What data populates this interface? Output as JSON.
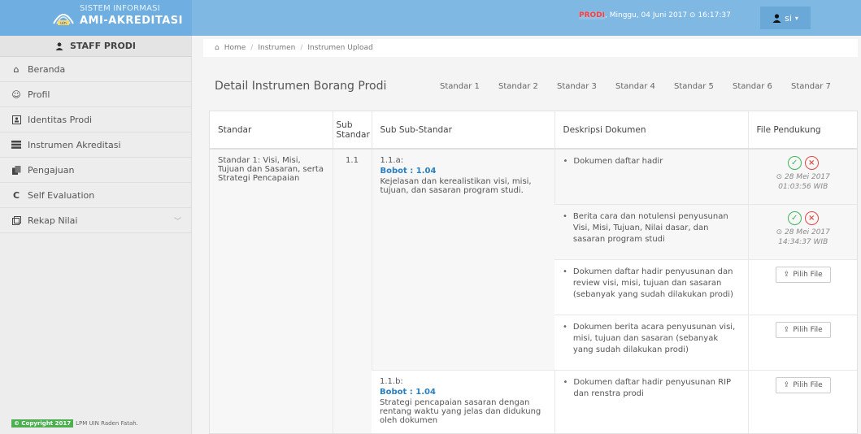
{
  "brand": {
    "line1": "SISTEM INFORMASI",
    "line2": "AMI-AKREDITASI"
  },
  "topbar": {
    "prodi": "PRODI",
    "datetime": ", Minggu, 04 Juni 2017 ⊙ 16:17:37",
    "user": "si"
  },
  "sidebar": {
    "header": "STAFF PRODI",
    "items": [
      {
        "label": "Beranda",
        "icon": "home-icon"
      },
      {
        "label": "Profil",
        "icon": "user-circle-icon"
      },
      {
        "label": "Identitas Prodi",
        "icon": "id-card-icon"
      },
      {
        "label": "Instrumen Akreditasi",
        "icon": "server-icon"
      },
      {
        "label": "Pengajuan",
        "icon": "copy-icon"
      },
      {
        "label": "Self Evaluation",
        "icon": "refresh-icon"
      },
      {
        "label": "Rekap Nilai",
        "icon": "clone-icon"
      }
    ],
    "copyright_badge": "© Copyright 2017",
    "copyright_text": "LPM UIN Raden Fatah."
  },
  "breadcrumb": {
    "home": "Home",
    "b1": "Instrumen",
    "b2": "Instrumen Upload"
  },
  "title": "Detail Instrumen Borang Prodi",
  "tabs": [
    "Standar 1",
    "Standar 2",
    "Standar 3",
    "Standar 4",
    "Standar 5",
    "Standar 6",
    "Standar 7"
  ],
  "table": {
    "headers": {
      "standar": "Standar",
      "sub": "Sub Standar",
      "subsub": "Sub Sub-Standar",
      "deskripsi": "Deskripsi Dokumen",
      "file": "File Pendukung"
    },
    "standar": "Standar 1: Visi, Misi, Tujuan dan Sasaran, serta Strategi Pencapaian",
    "sub": "1.1",
    "group_a": {
      "code": "1.1.a:",
      "bobot": "Bobot : 1.04",
      "text": "Kejelasan dan kerealistikan visi, misi, tujuan, dan sasaran program studi."
    },
    "group_b": {
      "code": "1.1.b:",
      "bobot": "Bobot : 1.04",
      "text": "Strategi pencapaian sasaran dengan rentang waktu yang jelas dan didukung oleh dokumen"
    },
    "docs": [
      {
        "desc": "Dokumen daftar hadir",
        "date": "⊙ 28 Mei 2017",
        "time": "01:03:56 WIB"
      },
      {
        "desc": "Berita cara dan notulensi penyusunan Visi, Misi, Tujuan, Nilai dasar, dan sasaran program studi",
        "date": "⊙ 28 Mei 2017",
        "time": "14:34:37 WIB"
      },
      {
        "desc": "Dokumen daftar hadir penyusunan dan review visi, misi, tujuan dan sasaran (sebanyak yang sudah dilakukan prodi)",
        "button": "Pilih File"
      },
      {
        "desc": "Dokumen berita acara penyusunan visi, misi, tujuan dan sasaran (sebanyak yang sudah dilakukan prodi)",
        "button": "Pilih File"
      },
      {
        "desc": "Dokumen daftar hadir penyusunan RIP dan renstra prodi",
        "button": "Pilih File"
      }
    ]
  }
}
